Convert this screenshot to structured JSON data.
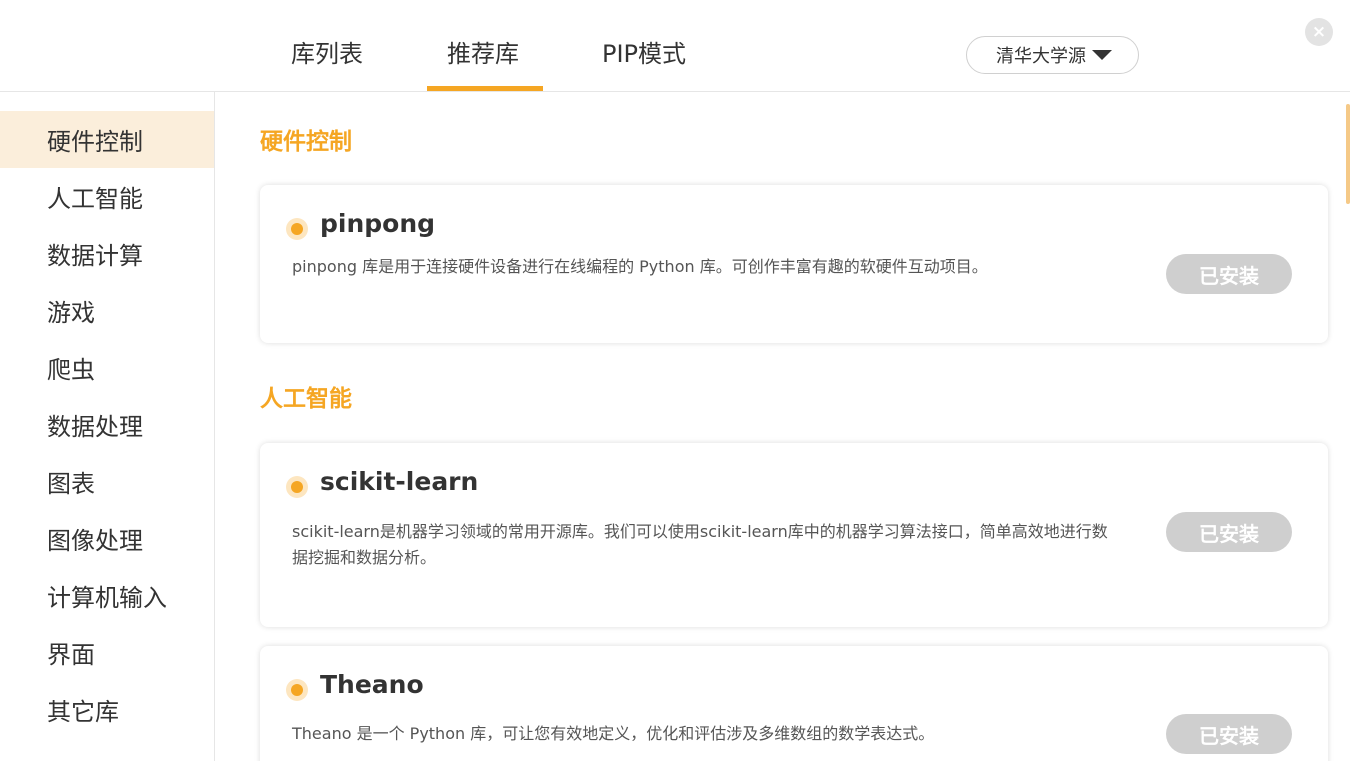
{
  "tabs": [
    {
      "label": "库列表"
    },
    {
      "label": "推荐库"
    },
    {
      "label": "PIP模式"
    }
  ],
  "source_select": {
    "value": "清华大学源"
  },
  "close_symbol": "×",
  "sidebar": {
    "items": [
      {
        "label": "硬件控制"
      },
      {
        "label": "人工智能"
      },
      {
        "label": "数据计算"
      },
      {
        "label": "游戏"
      },
      {
        "label": "爬虫"
      },
      {
        "label": "数据处理"
      },
      {
        "label": "图表"
      },
      {
        "label": "图像处理"
      },
      {
        "label": "计算机输入"
      },
      {
        "label": "界面"
      },
      {
        "label": "其它库"
      }
    ]
  },
  "sections": [
    {
      "title": "硬件控制",
      "cards": [
        {
          "name": "pinpong",
          "desc": "pinpong 库是用于连接硬件设备进行在线编程的 Python 库。可创作丰富有趣的软硬件互动项目。",
          "button": "已安装"
        }
      ]
    },
    {
      "title": "人工智能",
      "cards": [
        {
          "name": "scikit-learn",
          "desc": "scikit-learn是机器学习领域的常用开源库。我们可以使用scikit-learn库中的机器学习算法接口，简单高效地进行数据挖掘和数据分析。",
          "button": "已安装"
        },
        {
          "name": "Theano",
          "desc": "Theano 是一个 Python 库，可让您有效地定义，优化和评估涉及多维数组的数学表达式。",
          "button": "已安装"
        }
      ]
    }
  ],
  "colors": {
    "accent": "#f5a623",
    "active_bg": "#fbeedb",
    "installed_btn": "#cfcfcf"
  }
}
